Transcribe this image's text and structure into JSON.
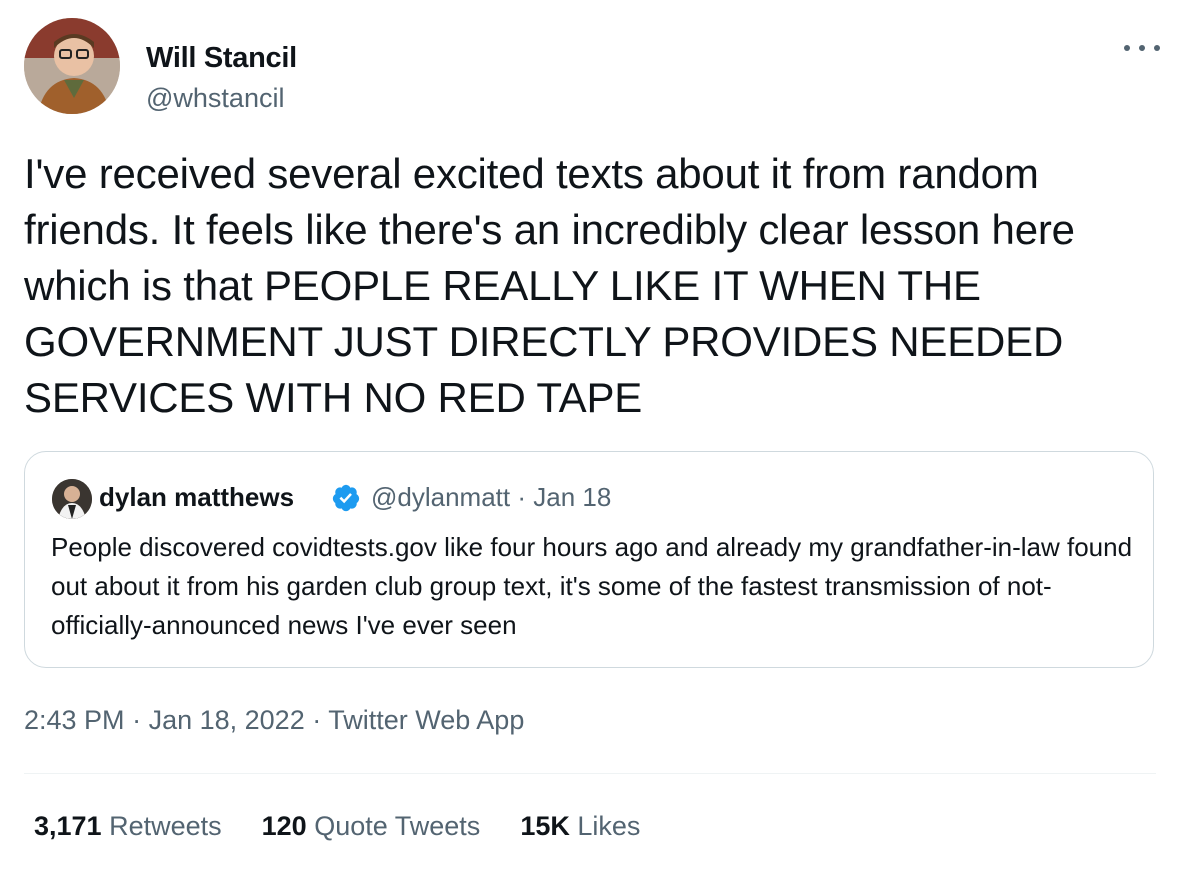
{
  "author": {
    "name": "Will Stancil",
    "handle": "@whstancil"
  },
  "tweet": {
    "text": "I've received several excited texts about it from random friends. It feels like there's an incredibly clear lesson here which is that PEOPLE REALLY LIKE IT WHEN THE GOVERNMENT JUST DIRECTLY PROVIDES NEEDED SERVICES WITH NO RED TAPE"
  },
  "quote": {
    "name": "dylan matthews",
    "handle": "@dylanmatt",
    "date": "Jan 18",
    "text": "People discovered covidtests.gov like four hours ago and already my grandfather-in-law found out about it from his garden club group text, it's some of the fastest transmission of not-officially-announced news I've ever seen"
  },
  "meta": {
    "time": "2:43 PM",
    "date": "Jan 18, 2022",
    "source": "Twitter Web App"
  },
  "stats": {
    "retweets": "3,171",
    "retweets_label": "Retweets",
    "quotes": "120",
    "quotes_label": "Quote Tweets",
    "likes": "15K",
    "likes_label": "Likes"
  },
  "icons": {
    "more": "more-options-icon",
    "verified": "verified-badge-icon"
  },
  "colors": {
    "text": "#0f1419",
    "secondary": "#536471",
    "border": "#cfd9de",
    "verified": "#1d9bf0"
  }
}
